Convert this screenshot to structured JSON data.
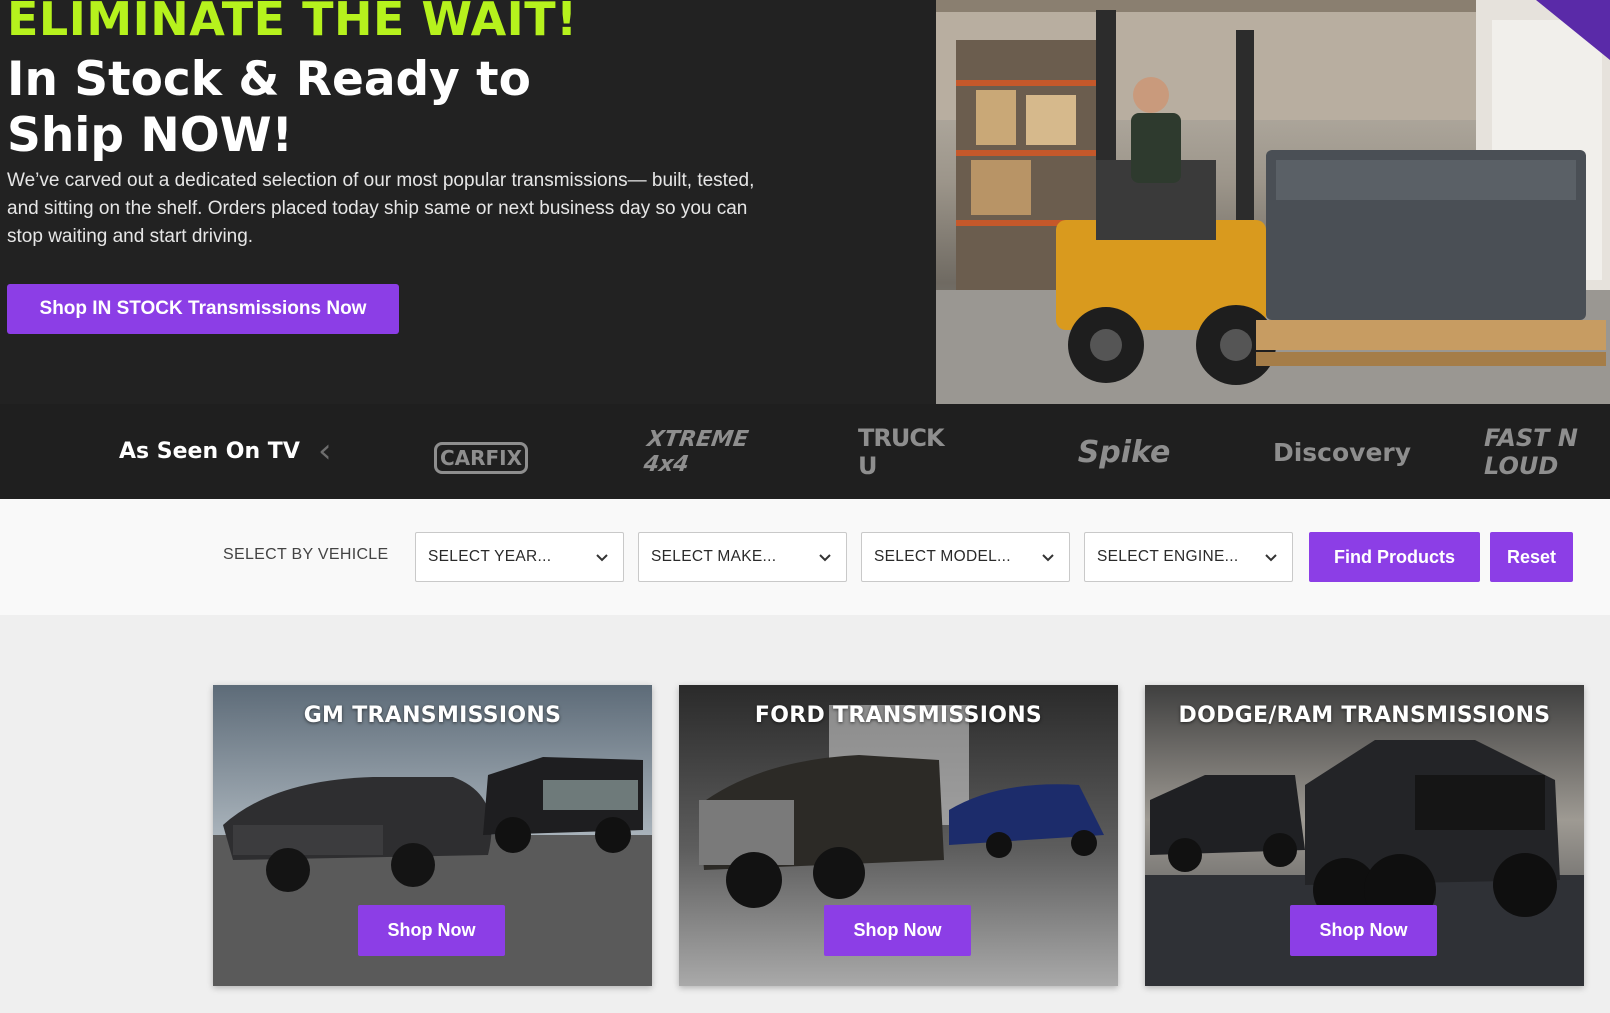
{
  "hero": {
    "headline_top": "ELIMINATE THE WAIT!",
    "headline_main": "In Stock & Ready to Ship NOW!",
    "description": "We’ve carved out a dedicated selection of our most popular transmissions— built, tested, and sitting on the shelf. Orders placed today ship same or next business day so you can stop waiting and start driving.",
    "cta_label": "Shop IN STOCK Transmissions Now"
  },
  "tv_strip": {
    "title": "As Seen On TV",
    "logos": [
      "CARFIX",
      "XTREME 4x4",
      "TRUCK U",
      "Spike",
      "Discovery",
      "FAST N LOUD"
    ]
  },
  "vehicle_select": {
    "label": "SELECT BY VEHICLE",
    "year": "SELECT YEAR...",
    "make": "SELECT MAKE...",
    "model": "SELECT MODEL...",
    "engine": "SELECT ENGINE...",
    "find_label": "Find Products",
    "reset_label": "Reset"
  },
  "cards": [
    {
      "title": "GM TRANSMISSIONS",
      "button": "Shop Now"
    },
    {
      "title": "FORD TRANSMISSIONS",
      "button": "Shop Now"
    },
    {
      "title": "DODGE/RAM TRANSMISSIONS",
      "button": "Shop Now"
    }
  ],
  "colors": {
    "accent_purple": "#8c3ee6",
    "accent_lime": "#b6f21d",
    "hero_bg": "#222222",
    "tv_bg": "#1f1f1f"
  }
}
